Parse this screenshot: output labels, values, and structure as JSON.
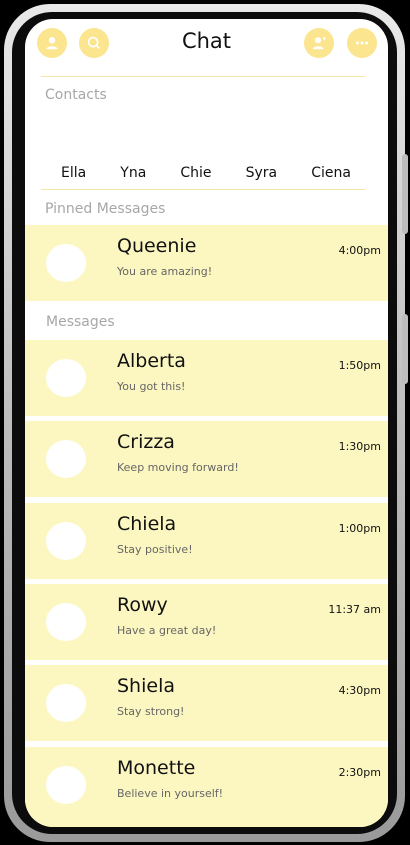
{
  "header": {
    "title": "Chat"
  },
  "sections": {
    "contacts": "Contacts",
    "pinned": "Pinned Messages",
    "messages": "Messages"
  },
  "contacts": [
    "Ella",
    "Yna",
    "Chie",
    "Syra",
    "Ciena"
  ],
  "pinned": [
    {
      "name": "Queenie",
      "preview": "You are amazing!",
      "time": "4:00pm"
    }
  ],
  "messages": [
    {
      "name": "Alberta",
      "preview": "You got this!",
      "time": "1:50pm"
    },
    {
      "name": "Crizza",
      "preview": "Keep moving forward!",
      "time": "1:30pm"
    },
    {
      "name": "Chiela",
      "preview": "Stay positive!",
      "time": "1:00pm"
    },
    {
      "name": "Rowy",
      "preview": "Have a great day!",
      "time": "11:37 am"
    },
    {
      "name": "Shiela",
      "preview": "Stay strong!",
      "time": "4:30pm"
    },
    {
      "name": "Monette",
      "preview": "Believe in yourself!",
      "time": "2:30pm"
    }
  ],
  "icons": {
    "left_1": "user-icon",
    "left_2": "search-icon",
    "right_1": "add-user-icon",
    "right_2": "more-icon"
  },
  "colors": {
    "accent": "#fbe58e",
    "row_bg": "#fcf7c1",
    "divider": "#f4e6a6"
  }
}
